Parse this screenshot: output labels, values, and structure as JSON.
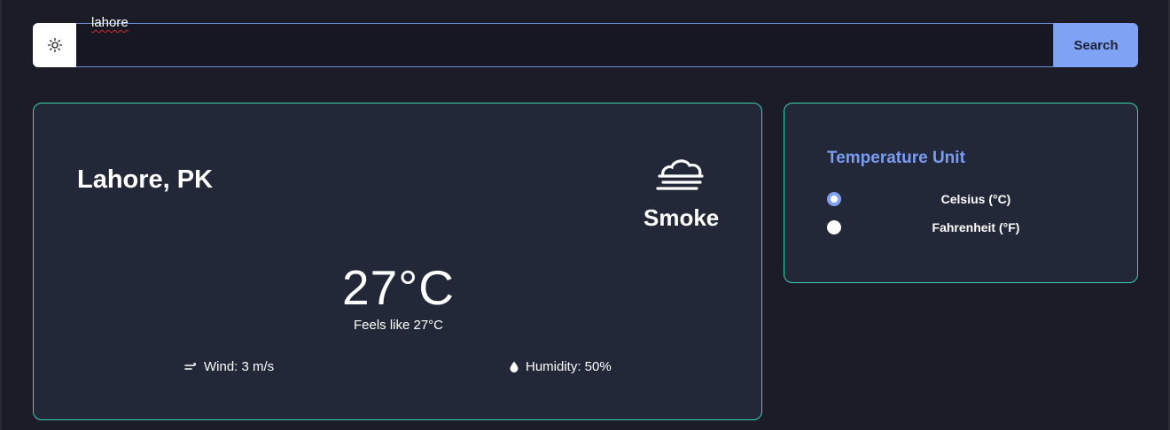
{
  "search": {
    "value": "lahore",
    "button_label": "Search",
    "theme_icon": "sun-icon"
  },
  "weather": {
    "city": "Lahore, PK",
    "condition": "Smoke",
    "condition_icon": "fog-icon",
    "temperature": "27°C",
    "feels_like": "Feels like 27°C",
    "wind": "Wind: 3 m/s",
    "wind_icon": "wind-icon",
    "humidity": "Humidity: 50%",
    "humidity_icon": "droplet-icon"
  },
  "units": {
    "title": "Temperature Unit",
    "options": [
      {
        "label": "Celsius (°C)",
        "checked": true
      },
      {
        "label": "Fahrenheit (°F)",
        "checked": false
      }
    ],
    "accent": "#7fa2f5"
  },
  "colors": {
    "background": "#1b1c27",
    "card": "#232839",
    "card_border": "#3fd0b4",
    "accent": "#7fa2f5"
  }
}
